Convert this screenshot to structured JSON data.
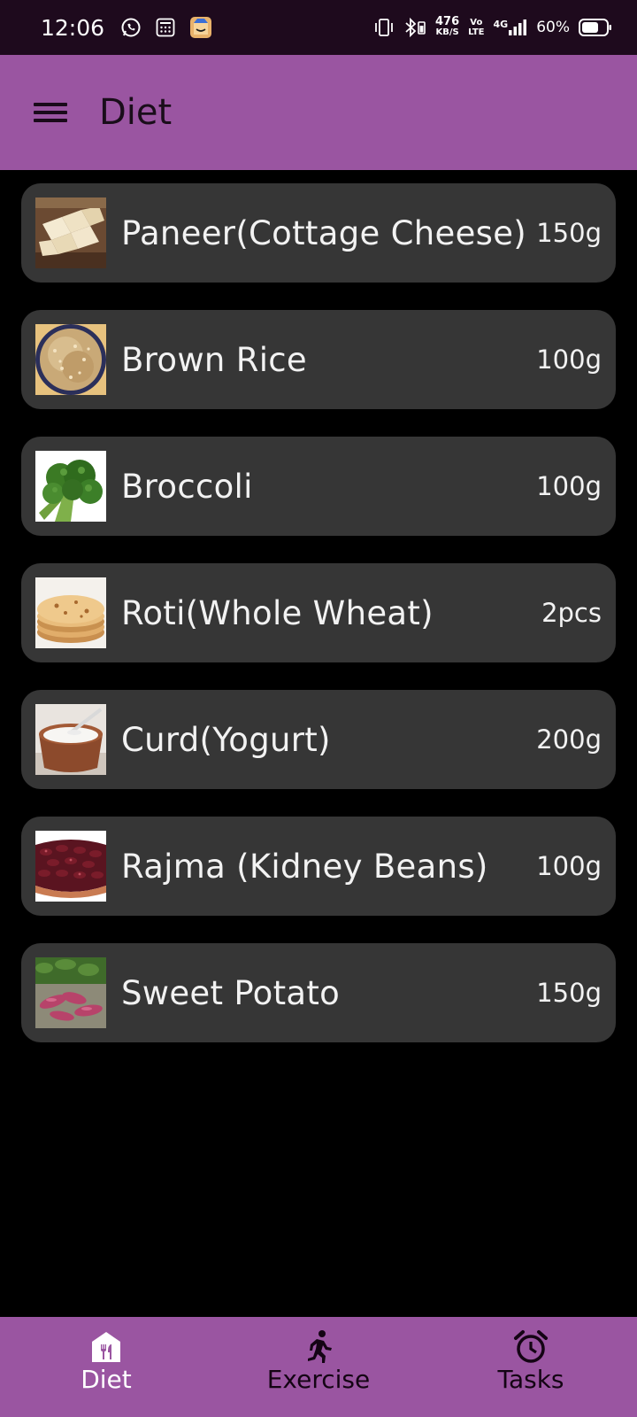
{
  "status_bar": {
    "time": "12:06",
    "speed_value": "476",
    "speed_unit": "KB/S",
    "volte_top": "Vo",
    "volte_bottom": "LTE",
    "network": "4G",
    "battery": "60%",
    "left_icons": [
      "whatsapp-icon",
      "calculator-icon",
      "shopping-icon"
    ],
    "right_icons": [
      "vibrate-icon",
      "bluetooth-icon",
      "signal-icon",
      "battery-icon"
    ]
  },
  "app_bar": {
    "title": "Diet",
    "menu_icon": "hamburger-menu-icon"
  },
  "diet": {
    "items": [
      {
        "name": "Paneer(Cottage Cheese)",
        "qty": "150g",
        "image": "paneer"
      },
      {
        "name": "Brown Rice",
        "qty": "100g",
        "image": "brown-rice"
      },
      {
        "name": "Broccoli",
        "qty": "100g",
        "image": "broccoli"
      },
      {
        "name": "Roti(Whole Wheat)",
        "qty": "2pcs",
        "image": "roti"
      },
      {
        "name": "Curd(Yogurt)",
        "qty": "200g",
        "image": "curd"
      },
      {
        "name": "Rajma (Kidney Beans)",
        "qty": "100g",
        "image": "rajma"
      },
      {
        "name": "Sweet Potato",
        "qty": "150g",
        "image": "sweet-potato"
      }
    ]
  },
  "bottom_nav": {
    "items": [
      {
        "label": "Diet",
        "icon": "diet-icon",
        "active": true
      },
      {
        "label": "Exercise",
        "icon": "running-icon",
        "active": false
      },
      {
        "label": "Tasks",
        "icon": "alarm-clock-icon",
        "active": false
      }
    ]
  },
  "colors": {
    "app_bar": "#9a55a1",
    "status_bar": "#1e0a1d",
    "card": "#363636",
    "background": "#000000"
  }
}
